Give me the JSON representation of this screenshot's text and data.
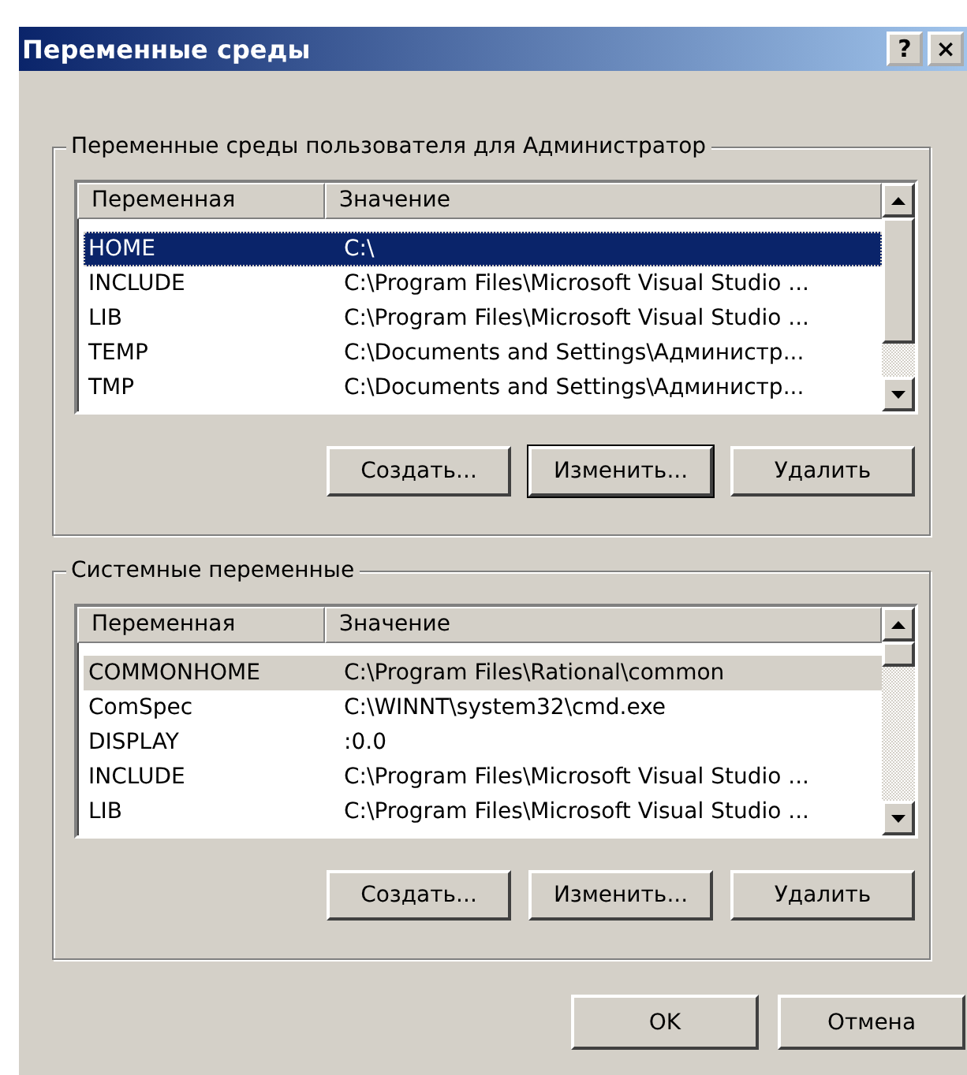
{
  "window": {
    "title": "Переменные среды",
    "title_buttons": [
      "?",
      "×"
    ]
  },
  "groups": [
    {
      "title": "Переменные среды пользователя для Администратор",
      "focused": true,
      "columns": [
        "Переменная",
        "Значение"
      ],
      "rows": [
        {
          "name": "HOME",
          "value": "C:\\",
          "selected": true
        },
        {
          "name": "INCLUDE",
          "value": "C:\\Program Files\\Microsoft Visual Studio ...",
          "selected": false
        },
        {
          "name": "LIB",
          "value": "C:\\Program Files\\Microsoft Visual Studio ...",
          "selected": false
        },
        {
          "name": "TEMP",
          "value": "C:\\Documents and Settings\\Администр...",
          "selected": false
        },
        {
          "name": "TMP",
          "value": "C:\\Documents and Settings\\Администр...",
          "selected": false
        }
      ],
      "buttons": [
        {
          "label": "Создать...",
          "default": false
        },
        {
          "label": "Изменить...",
          "default": true
        },
        {
          "label": "Удалить",
          "default": false
        }
      ]
    },
    {
      "title": "Системные переменные",
      "focused": false,
      "columns": [
        "Переменная",
        "Значение"
      ],
      "rows": [
        {
          "name": "COMMONHOME",
          "value": "C:\\Program Files\\Rational\\common",
          "selected": true
        },
        {
          "name": "ComSpec",
          "value": "C:\\WINNT\\system32\\cmd.exe",
          "selected": false
        },
        {
          "name": "DISPLAY",
          "value": ":0.0",
          "selected": false
        },
        {
          "name": "INCLUDE",
          "value": "C:\\Program Files\\Microsoft Visual Studio ...",
          "selected": false
        },
        {
          "name": "LIB",
          "value": "C:\\Program Files\\Microsoft Visual Studio ...",
          "selected": false
        }
      ],
      "buttons": [
        {
          "label": "Создать...",
          "default": false
        },
        {
          "label": "Изменить...",
          "default": false
        },
        {
          "label": "Удалить",
          "default": false
        }
      ]
    }
  ],
  "buttons": [
    "OK",
    "Отмена"
  ]
}
